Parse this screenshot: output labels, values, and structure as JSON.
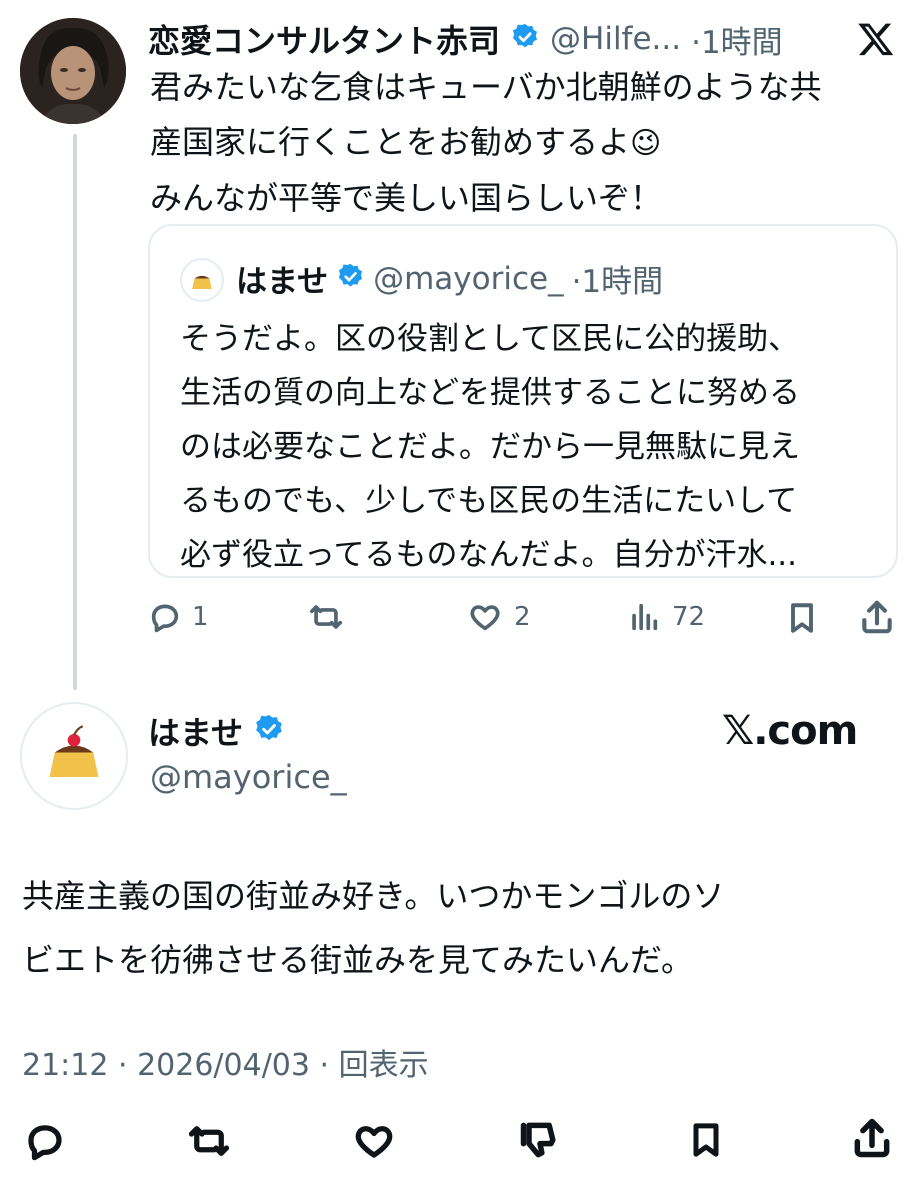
{
  "tweet1": {
    "author_name": "恋愛コンサルタント赤司",
    "author_handle": "@Hilfe...",
    "time": "·1時間",
    "text_lines": [
      "君みたいな乞食はキューバか北朝鮮のような共",
      "産国家に行くことをお勧めするよ",
      "みんなが平等で美しい国らしいぞ！"
    ],
    "emoji": "😉",
    "quote": {
      "author_name": "はませ",
      "author_handle": "@mayorice_",
      "time": "·1時間",
      "text_lines": [
        "そうだよ。区の役割として区民に公的援助、",
        "生活の質の向上などを提供することに努める",
        "のは必要なことだよ。だから一見無駄に見え",
        "るものでも、少しでも区民の生活にたいして",
        "必ず役立ってるものなんだよ。自分が汗水..."
      ]
    },
    "actions": {
      "replies": "1",
      "retweets": "",
      "likes": "2",
      "views": "72"
    }
  },
  "tweet2": {
    "author_name": "はませ",
    "author_handle": "@mayorice_",
    "brand": "𝕏.com",
    "text_lines": [
      "共産主義の国の街並み好き。いつかモンゴルのソ",
      "ビエトを彷彿させる街並みを見てみたいんだ。"
    ],
    "meta": "21:12 · 2026/04/03 · 回表示"
  },
  "header": {
    "close_icon": "x-logo-icon"
  },
  "colors": {
    "verified": "#1d9bf0",
    "secondary": "#536471",
    "text": "#0f1419",
    "border": "#e6ecf0"
  }
}
